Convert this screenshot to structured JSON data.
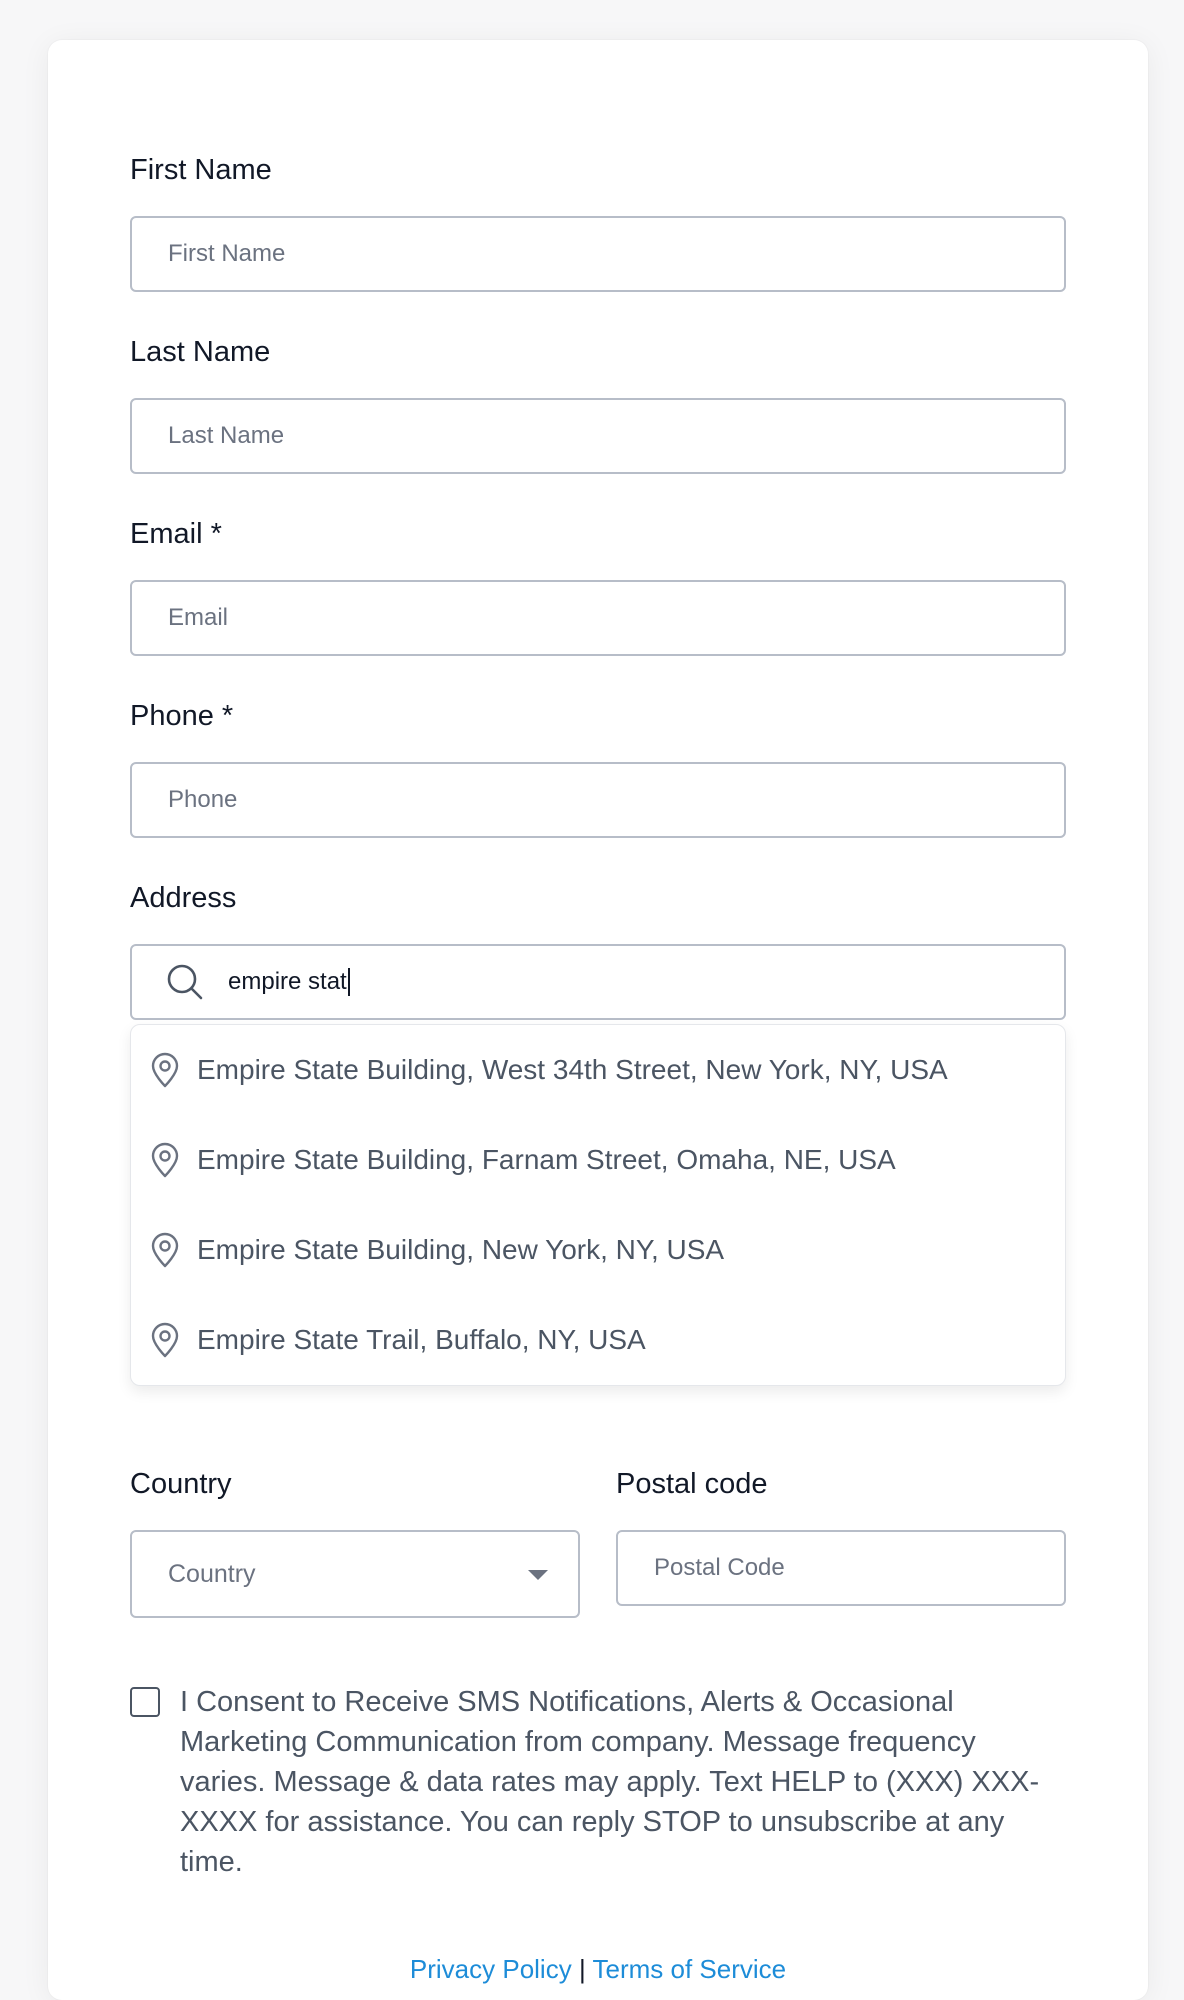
{
  "form": {
    "first_name": {
      "label": "First Name",
      "placeholder": "First Name"
    },
    "last_name": {
      "label": "Last Name",
      "placeholder": "Last Name"
    },
    "email": {
      "label": "Email *",
      "placeholder": "Email"
    },
    "phone": {
      "label": "Phone *",
      "placeholder": "Phone"
    },
    "address": {
      "label": "Address",
      "value": "empire stat",
      "icon": "search-icon",
      "suggestions": [
        {
          "text": "Empire State Building, West 34th Street, New York, NY, USA",
          "icon": "map-pin-icon"
        },
        {
          "text": "Empire State Building, Farnam Street, Omaha, NE, USA",
          "icon": "map-pin-icon"
        },
        {
          "text": "Empire State Building, New York, NY, USA",
          "icon": "map-pin-icon"
        },
        {
          "text": "Empire State Trail, Buffalo, NY, USA",
          "icon": "map-pin-icon"
        }
      ]
    },
    "country": {
      "label": "Country",
      "placeholder": "Country"
    },
    "postal_code": {
      "label": "Postal code",
      "placeholder": "Postal Code"
    },
    "consent": {
      "checked": false,
      "text": "I Consent to Receive SMS Notifications, Alerts & Occasional Marketing Communication from company. Message frequency varies. Message & data rates may apply. Text HELP to (XXX) XXX-XXXX for assistance. You can reply STOP to unsubscribe at any time."
    }
  },
  "footer": {
    "privacy_label": "Privacy Policy",
    "separator": "|",
    "terms_label": "Terms of Service",
    "link_color": "#1d8cd8"
  }
}
